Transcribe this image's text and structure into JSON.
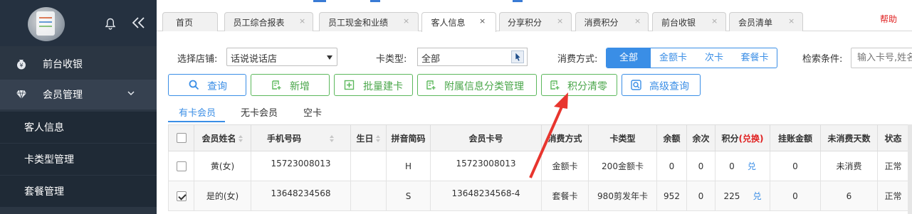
{
  "sidebar": {
    "items": [
      {
        "label": "前台收银"
      },
      {
        "label": "会员管理"
      }
    ],
    "subitems": [
      {
        "label": "客人信息"
      },
      {
        "label": "卡类型管理"
      },
      {
        "label": "套餐管理"
      }
    ]
  },
  "tabs": [
    {
      "label": "首页"
    },
    {
      "label": "员工综合报表"
    },
    {
      "label": "员工现金和业绩"
    },
    {
      "label": "客人信息"
    },
    {
      "label": "分享积分"
    },
    {
      "label": "消费积分"
    },
    {
      "label": "前台收银"
    },
    {
      "label": "会员清单"
    }
  ],
  "help_label": "帮助",
  "filters": {
    "store_label": "选择店铺:",
    "store_value": "话说说话店",
    "cardtype_label": "卡类型:",
    "cardtype_value": "全部",
    "consume_label": "消费方式:",
    "consume_options": [
      "全部",
      "金额卡",
      "次卡",
      "套餐卡"
    ],
    "search_label": "检索条件:",
    "search_placeholder": "输入卡号,姓名"
  },
  "buttons": {
    "query": "查询",
    "add": "新增",
    "batch": "批量建卡",
    "attach": "附属信息分类管理",
    "clear_points": "积分清零",
    "advanced": "高级查询"
  },
  "subtabs": [
    "有卡会员",
    "无卡会员",
    "空卡"
  ],
  "table": {
    "headers": [
      "会员姓名",
      "手机号码",
      "生日",
      "拼音简码",
      "会员卡号",
      "消费方式",
      "卡类型",
      "余额",
      "余次",
      "积分",
      "(兑换)",
      "挂账金额",
      "未消费天数",
      "状态"
    ],
    "exchange_label": "兑",
    "rows": [
      {
        "name": "黄(女)",
        "phone": "15723008013",
        "birthday": "",
        "pinyin": "H",
        "card": "15723008013",
        "consume": "金额卡",
        "cardtype": "200金额卡",
        "balance": "0",
        "times": "0",
        "points": "0",
        "credit": "0",
        "days": "未消费",
        "status": "正常"
      },
      {
        "name": "是的(女)",
        "phone": "13648234568",
        "birthday": "",
        "pinyin": "S",
        "card": "13648234568-4",
        "consume": "套餐卡",
        "cardtype": "980剪发年卡",
        "balance": "952",
        "times": "0",
        "points": "225",
        "credit": "0",
        "days": "6",
        "status": "正常"
      }
    ]
  },
  "colors": {
    "accent": "#3a8ee6",
    "sidebar": "#2b3643",
    "arrow": "#e8352e",
    "green": "#5cb85c"
  }
}
